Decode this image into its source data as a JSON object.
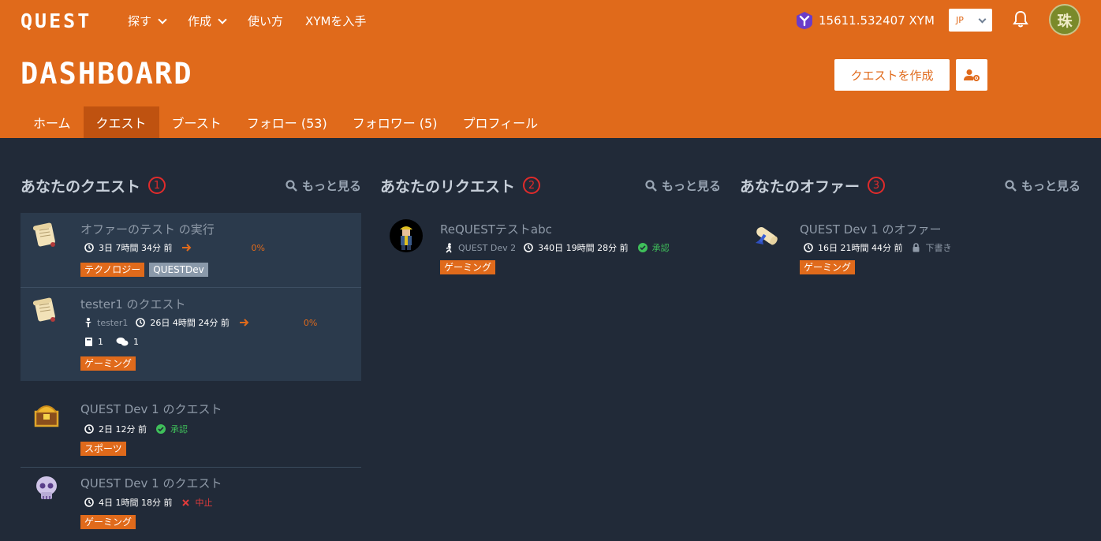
{
  "header": {
    "logo": "QUEST",
    "nav": [
      {
        "label": "探す",
        "dropdown": true
      },
      {
        "label": "作成",
        "dropdown": true
      },
      {
        "label": "使い方",
        "dropdown": false
      },
      {
        "label": "XYMを入手",
        "dropdown": false
      }
    ],
    "balance": "15611.532407 XYM",
    "lang": "JP",
    "avatar_text": "珠"
  },
  "dashboard": {
    "title": "DASHBOARD",
    "create_label": "クエストを作成",
    "tabs": [
      "ホーム",
      "クエスト",
      "ブースト",
      "フォロー (53)",
      "フォロワー (5)",
      "プロフィール"
    ],
    "active_tab": "クエスト"
  },
  "columns": {
    "quests": {
      "title": "あなたのクエスト",
      "num": "1",
      "more": "もっと見る",
      "items": [
        {
          "title": "オファーのテスト の実行",
          "time": "3日 7時間 34分 前",
          "pct": "0%",
          "tags": [
            "テクノロジー",
            "QUESTDev"
          ]
        },
        {
          "title": "tester1 のクエスト",
          "user": "tester1",
          "time": "26日 4時間 24分 前",
          "pct": "0%",
          "count1": "1",
          "count2": "1",
          "tags": [
            "ゲーミング"
          ]
        },
        {
          "title": "QUEST Dev 1 のクエスト",
          "time": "2日 12分 前",
          "status": "承認",
          "tags": [
            "スポーツ"
          ]
        },
        {
          "title": "QUEST Dev 1 のクエスト",
          "time": "4日 1時間 18分 前",
          "status": "中止",
          "tags": [
            "ゲーミング"
          ]
        }
      ]
    },
    "requests": {
      "title": "あなたのリクエスト",
      "num": "2",
      "more": "もっと見る",
      "items": [
        {
          "title": "ReQUESTテストabc",
          "user": "QUEST Dev 2",
          "time": "340日 19時間 28分 前",
          "status": "承認",
          "tags": [
            "ゲーミング"
          ]
        }
      ]
    },
    "offers": {
      "title": "あなたのオファー",
      "num": "3",
      "more": "もっと見る",
      "items": [
        {
          "title": "QUEST Dev 1 のオファー",
          "time": "16日 21時間 44分 前",
          "status": "下書き",
          "tags": [
            "ゲーミング"
          ]
        }
      ]
    }
  },
  "colors": {
    "accent": "#e06a1b",
    "background": "#212a38",
    "success": "#3fbf5a",
    "danger": "#e03b3b"
  }
}
